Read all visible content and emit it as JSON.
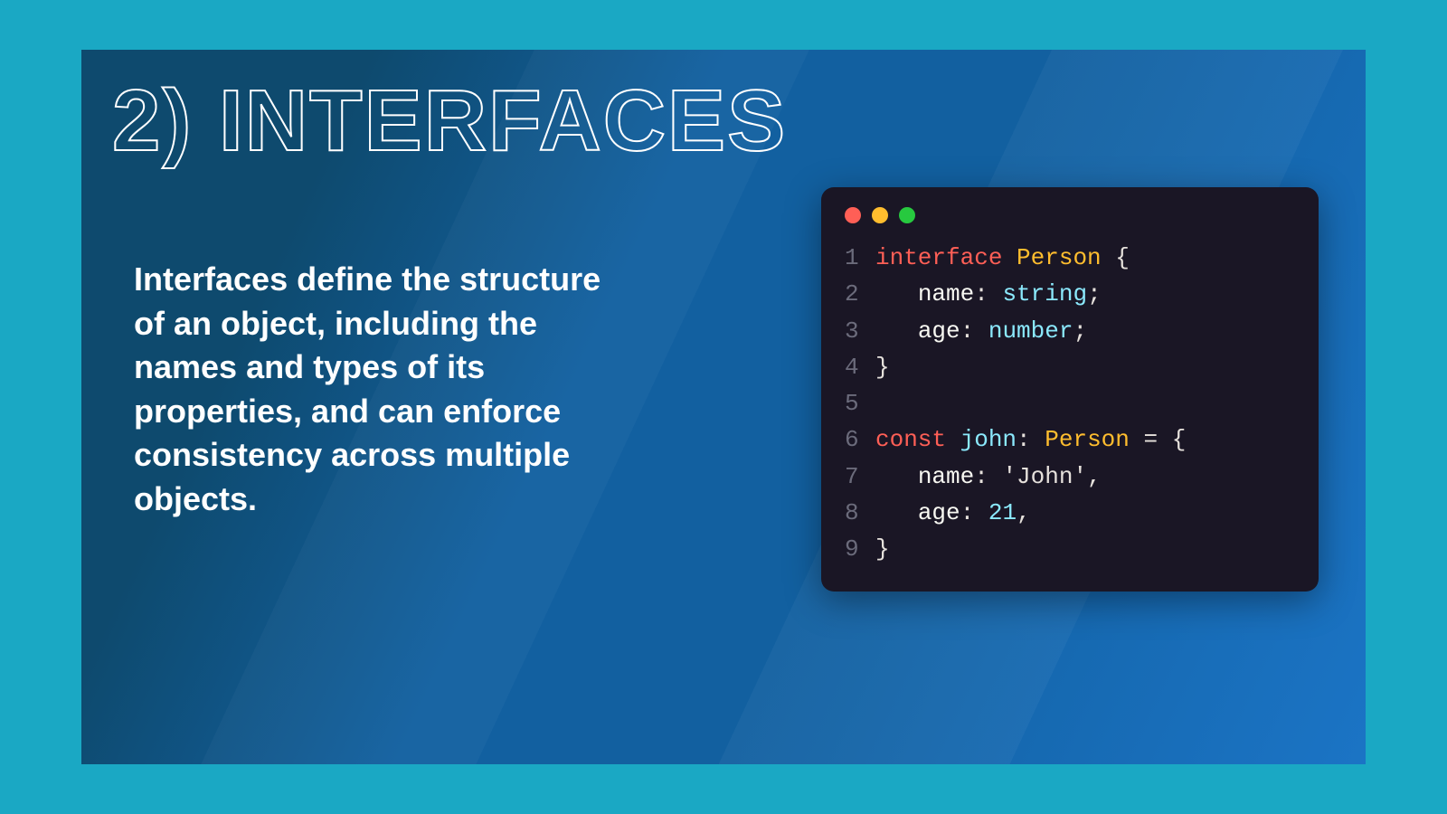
{
  "heading": "2) INTERFACES",
  "description": "Interfaces define the structure of an object, including the names and types of its properties, and can enforce consistency across multiple objects.",
  "code": {
    "lines": [
      {
        "n": "1",
        "tokens": [
          {
            "t": "interface",
            "c": "c-keyword"
          },
          {
            "t": " ",
            "c": "c-default"
          },
          {
            "t": "Person",
            "c": "c-type"
          },
          {
            "t": " {",
            "c": "c-default"
          }
        ]
      },
      {
        "n": "2",
        "tokens": [
          {
            "t": "   ",
            "c": "c-default"
          },
          {
            "t": "name",
            "c": "c-prop"
          },
          {
            "t": ": ",
            "c": "c-default"
          },
          {
            "t": "string",
            "c": "c-ident"
          },
          {
            "t": ";",
            "c": "c-default"
          }
        ]
      },
      {
        "n": "3",
        "tokens": [
          {
            "t": "   ",
            "c": "c-default"
          },
          {
            "t": "age",
            "c": "c-prop"
          },
          {
            "t": ": ",
            "c": "c-default"
          },
          {
            "t": "number",
            "c": "c-ident"
          },
          {
            "t": ";",
            "c": "c-default"
          }
        ]
      },
      {
        "n": "4",
        "tokens": [
          {
            "t": "}",
            "c": "c-default"
          }
        ]
      },
      {
        "n": "5",
        "tokens": [
          {
            "t": " ",
            "c": "c-default"
          }
        ]
      },
      {
        "n": "6",
        "tokens": [
          {
            "t": "const",
            "c": "c-keyword"
          },
          {
            "t": " ",
            "c": "c-default"
          },
          {
            "t": "john",
            "c": "c-ident"
          },
          {
            "t": ": ",
            "c": "c-default"
          },
          {
            "t": "Person",
            "c": "c-type"
          },
          {
            "t": " = {",
            "c": "c-default"
          }
        ]
      },
      {
        "n": "7",
        "tokens": [
          {
            "t": "   ",
            "c": "c-default"
          },
          {
            "t": "name",
            "c": "c-prop"
          },
          {
            "t": ": ",
            "c": "c-default"
          },
          {
            "t": "'John'",
            "c": "c-string"
          },
          {
            "t": ",",
            "c": "c-default"
          }
        ]
      },
      {
        "n": "8",
        "tokens": [
          {
            "t": "   ",
            "c": "c-default"
          },
          {
            "t": "age",
            "c": "c-prop"
          },
          {
            "t": ": ",
            "c": "c-default"
          },
          {
            "t": "21",
            "c": "c-ident"
          },
          {
            "t": ",",
            "c": "c-default"
          }
        ]
      },
      {
        "n": "9",
        "tokens": [
          {
            "t": "}",
            "c": "c-default"
          }
        ]
      }
    ]
  }
}
